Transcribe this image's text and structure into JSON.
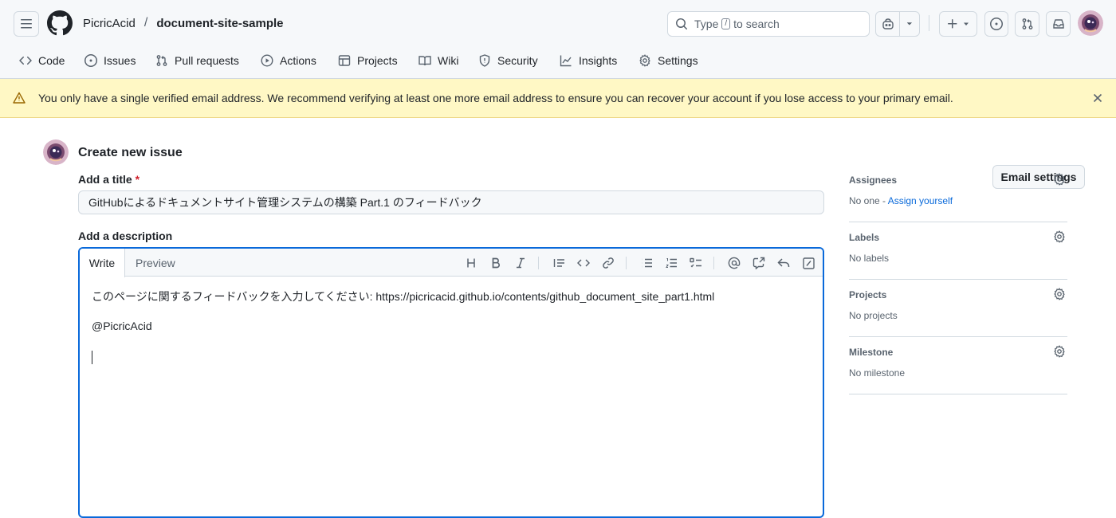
{
  "header": {
    "owner": "PicricAcid",
    "separator": "/",
    "repo": "document-site-sample",
    "search": {
      "prefix": "Type",
      "key": "/",
      "suffix": "to search"
    }
  },
  "nav": {
    "items": [
      {
        "label": "Code",
        "icon": "code-icon"
      },
      {
        "label": "Issues",
        "icon": "issue-opened-icon"
      },
      {
        "label": "Pull requests",
        "icon": "git-pull-request-icon"
      },
      {
        "label": "Actions",
        "icon": "play-icon"
      },
      {
        "label": "Projects",
        "icon": "table-icon"
      },
      {
        "label": "Wiki",
        "icon": "book-icon"
      },
      {
        "label": "Security",
        "icon": "shield-icon"
      },
      {
        "label": "Insights",
        "icon": "graph-icon"
      },
      {
        "label": "Settings",
        "icon": "gear-icon"
      }
    ]
  },
  "banner": {
    "message": "You only have a single verified email address. We recommend verifying at least one more email address to ensure you can recover your account if you lose access to your primary email.",
    "button": "Email settings",
    "color": "#fff8c5"
  },
  "form": {
    "heading": "Create new issue",
    "title_label": "Add a title",
    "required_mark": "*",
    "title_value": "GitHubによるドキュメントサイト管理システムの構築 Part.1 のフィードバック",
    "description_label": "Add a description",
    "tabs": {
      "write": "Write",
      "preview": "Preview"
    },
    "body_lines": [
      "このページに関するフィードバックを入力してください: https://picricacid.github.io/contents/github_document_site_part1.html",
      "@PicricAcid"
    ],
    "focus_color": "#0969da"
  },
  "sidebar": {
    "assignees": {
      "title": "Assignees",
      "value_prefix": "No one - ",
      "value_link": "Assign yourself"
    },
    "labels": {
      "title": "Labels",
      "value": "No labels"
    },
    "projects": {
      "title": "Projects",
      "value": "No projects"
    },
    "milestone": {
      "title": "Milestone",
      "value": "No milestone"
    }
  }
}
